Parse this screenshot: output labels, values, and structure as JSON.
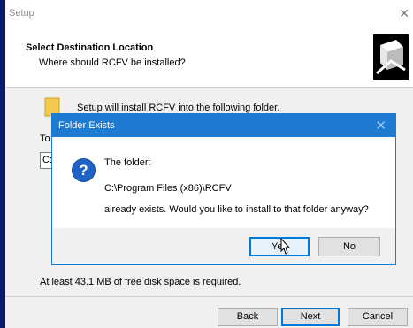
{
  "setup": {
    "title": "Setup",
    "close_glyph": "✕",
    "header_title": "Select Destination Location",
    "header_subtitle": "Where should RCFV be installed?",
    "install_text": "Setup will install RCFV into the following folder.",
    "to_label": "To",
    "path_value": "C:",
    "disk_text": "At least 43.1 MB of free disk space is required.",
    "buttons": {
      "back": "Back",
      "next": "Next",
      "cancel": "Cancel"
    }
  },
  "dialog": {
    "title": "Folder Exists",
    "close_glyph": "✕",
    "icon": "question-icon",
    "icon_glyph": "?",
    "line1": "The folder:",
    "line2": "C:\\Program Files (x86)\\RCFV",
    "line3": "already exists. Would you like to install to that folder anyway?",
    "buttons": {
      "yes": "Yes",
      "no": "No"
    }
  },
  "colors": {
    "desktop": "#1b2f8f",
    "dialog_titlebar": "#1f7ad1",
    "focus_border": "#0078d7"
  }
}
